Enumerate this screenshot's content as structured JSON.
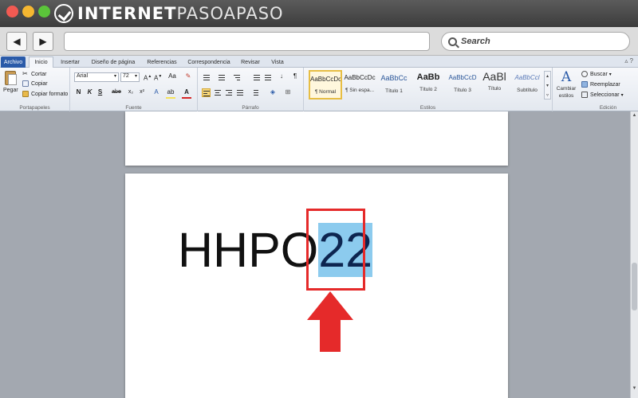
{
  "browser": {
    "logo_text_main": "INTERNET",
    "logo_text_accent": "PASOAPASO",
    "search_placeholder": "Search",
    "back_icon": "back-arrow-icon",
    "forward_icon": "forward-arrow-icon"
  },
  "ribbon_tabs": [
    "Archivo",
    "Inicio",
    "Insertar",
    "Diseño de página",
    "Referencias",
    "Correspondencia",
    "Revisar",
    "Vista"
  ],
  "clipboard": {
    "paste_label": "Pegar",
    "cut_label": "Cortar",
    "copy_label": "Copiar",
    "format_painter_label": "Copiar formato",
    "group_label": "Portapapeles"
  },
  "font": {
    "font_name": "Arial",
    "font_size": "72",
    "bold": "N",
    "italic": "K",
    "underline": "S",
    "strike": "abe",
    "subscript": "x₂",
    "superscript": "x²",
    "change_case": "Aa",
    "group_label": "Fuente"
  },
  "paragraph": {
    "sort_glyph": "↓",
    "pilcrow": "¶",
    "group_label": "Párrafo"
  },
  "styles": {
    "items": [
      {
        "sample": "AaBbCcDc",
        "name": "¶ Normal"
      },
      {
        "sample": "AaBbCcDc",
        "name": "¶ Sin espa..."
      },
      {
        "sample": "AaBbCc",
        "name": "Título 1"
      },
      {
        "sample": "AaBb",
        "name": "Título 2"
      },
      {
        "sample": "AaBbCcD",
        "name": "Título 3"
      },
      {
        "sample": "AaBl",
        "name": "Título"
      },
      {
        "sample": "AaBbCcl",
        "name": "Subtítulo"
      }
    ],
    "change_styles_label_1": "Cambiar",
    "change_styles_label_2": "estilos",
    "group_label": "Estilos"
  },
  "editing": {
    "find_label": "Buscar",
    "replace_label": "Reemplazar",
    "select_label": "Seleccionar",
    "group_label": "Edición"
  },
  "document": {
    "text_plain": "HHPO",
    "text_selected": "22"
  },
  "colors": {
    "selection_highlight": "#8ccbee",
    "annotation_red": "#e52a2a",
    "archivo_tab": "#2a5aa8",
    "highlight_yellow": "#f5e25a",
    "font_red": "#d62828"
  }
}
